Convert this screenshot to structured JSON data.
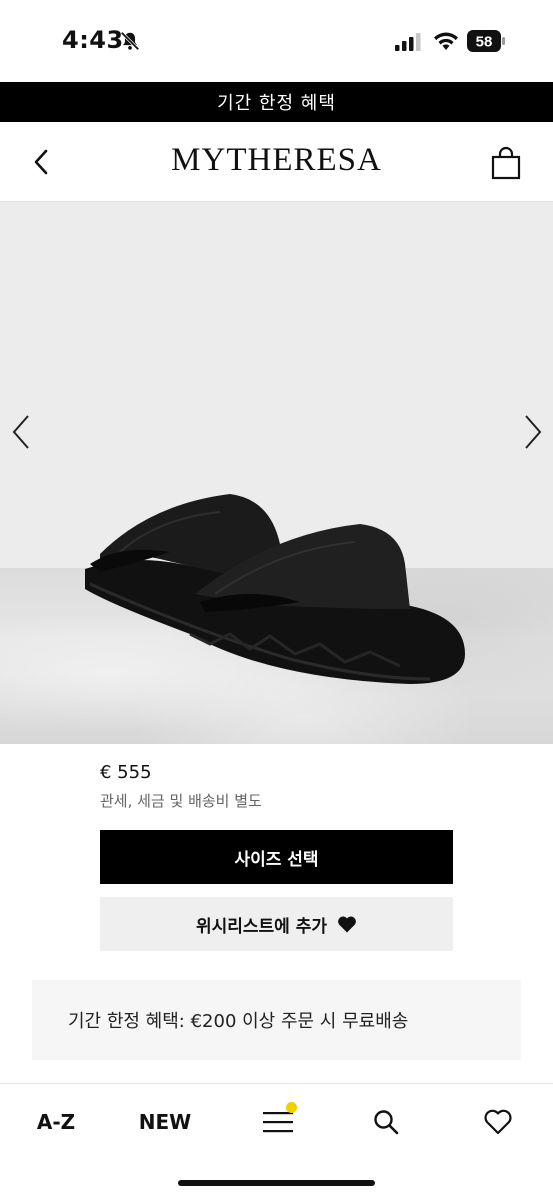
{
  "status_bar": {
    "time": "4:43",
    "battery": "58"
  },
  "promo_banner": {
    "text": "기간 한정 혜택"
  },
  "header": {
    "brand": "MYTHERESA"
  },
  "product": {
    "price": "€ 555",
    "price_note": "관세, 세금 및 배송비 별도",
    "size_button": "사이즈 선택",
    "wishlist_button": "위시리스트에 추가"
  },
  "shipping": {
    "text": "기간 한정 혜택: €200 이상 주문 시 무료배송"
  },
  "tab_bar": {
    "az": "A-Z",
    "new": "NEW",
    "menu_badge_color": "#f2cf00"
  },
  "icons": {
    "bell": "bell-slash-icon",
    "signal": "cellular-signal-icon",
    "wifi": "wifi-icon",
    "battery": "battery-icon",
    "back": "chevron-left-icon",
    "bag": "shopping-bag-icon",
    "prev": "chevron-left-icon",
    "next": "chevron-right-icon",
    "heart": "heart-icon",
    "menu": "hamburger-menu-icon",
    "search": "search-icon",
    "wishlist_tab": "heart-outline-icon"
  }
}
